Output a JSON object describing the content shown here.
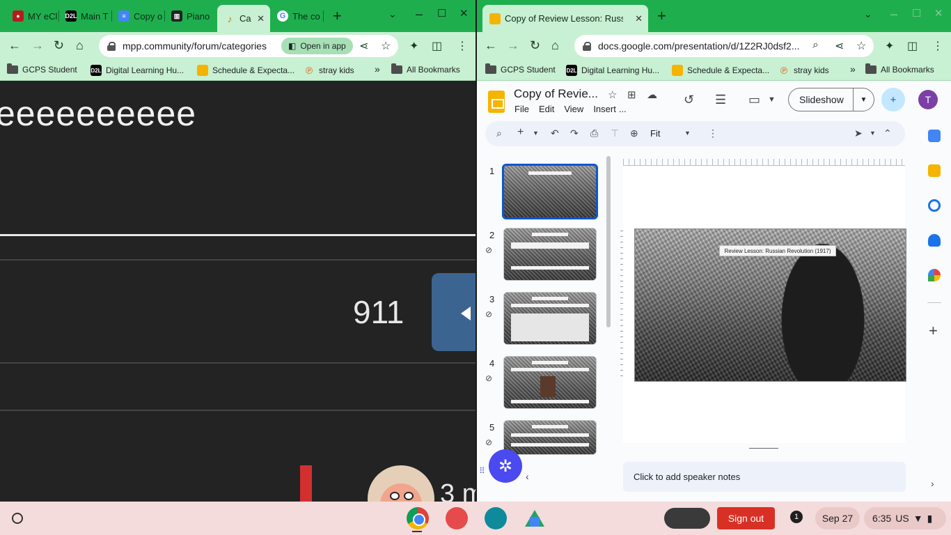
{
  "left_window": {
    "tabs": [
      {
        "label": "MY eCl",
        "favicon": "red-person"
      },
      {
        "label": "Main T",
        "favicon": "D2L"
      },
      {
        "label": "Copy o",
        "favicon": "docs-blue"
      },
      {
        "label": "Piano",
        "favicon": "piano"
      },
      {
        "label": "Ca",
        "favicon": "music-note",
        "active": true
      },
      {
        "label": "The co",
        "favicon": "google-g"
      }
    ],
    "address": "mpp.community/forum/categories",
    "open_in_app": "Open in app",
    "bookmarks": [
      {
        "label": "GCPS Student",
        "icon": "folder"
      },
      {
        "label": "Digital Learning Hu...",
        "icon": "D2L"
      },
      {
        "label": "Schedule & Expecta...",
        "icon": "slides-yellow"
      },
      {
        "label": "stray kids",
        "icon": "pinterest-p"
      }
    ],
    "more_bookmarks": "»",
    "all_bookmarks": "All Bookmarks",
    "content": {
      "heading_text": "eeeeeeeeee",
      "count": "911",
      "partial_text": "3 m"
    }
  },
  "right_window": {
    "tab_title": "Copy of Review Lesson: Russian",
    "address": "docs.google.com/presentation/d/1Z2RJ0dsf2...",
    "bookmarks": [
      {
        "label": "GCPS Student"
      },
      {
        "label": "Digital Learning Hu..."
      },
      {
        "label": "Schedule & Expecta..."
      },
      {
        "label": "stray kids"
      }
    ],
    "more_bookmarks": "»",
    "all_bookmarks": "All Bookmarks",
    "doc_title": "Copy of Revie...",
    "menus": [
      "File",
      "Edit",
      "View",
      "Insert",
      "..."
    ],
    "slideshow_label": "Slideshow",
    "user_initial": "T",
    "zoom_label": "Fit",
    "slide_numbers": [
      "1",
      "2",
      "3",
      "4",
      "5"
    ],
    "selected_slide": 1,
    "current_slide_title": "Review Lesson: Russian Revolution (1917)",
    "speaker_notes_placeholder": "Click to add speaker notes"
  },
  "shelf": {
    "sign_out": "Sign out",
    "notification_count": "1",
    "date": "Sep 27",
    "time": "6:35",
    "locale": "US"
  },
  "colors": {
    "tab_strip": "#1fae4e",
    "toolbar": "#c8f0d2",
    "sign_out": "#d93025",
    "share_button": "#c2e7ff",
    "selected_thumb": "#0b57d0"
  }
}
